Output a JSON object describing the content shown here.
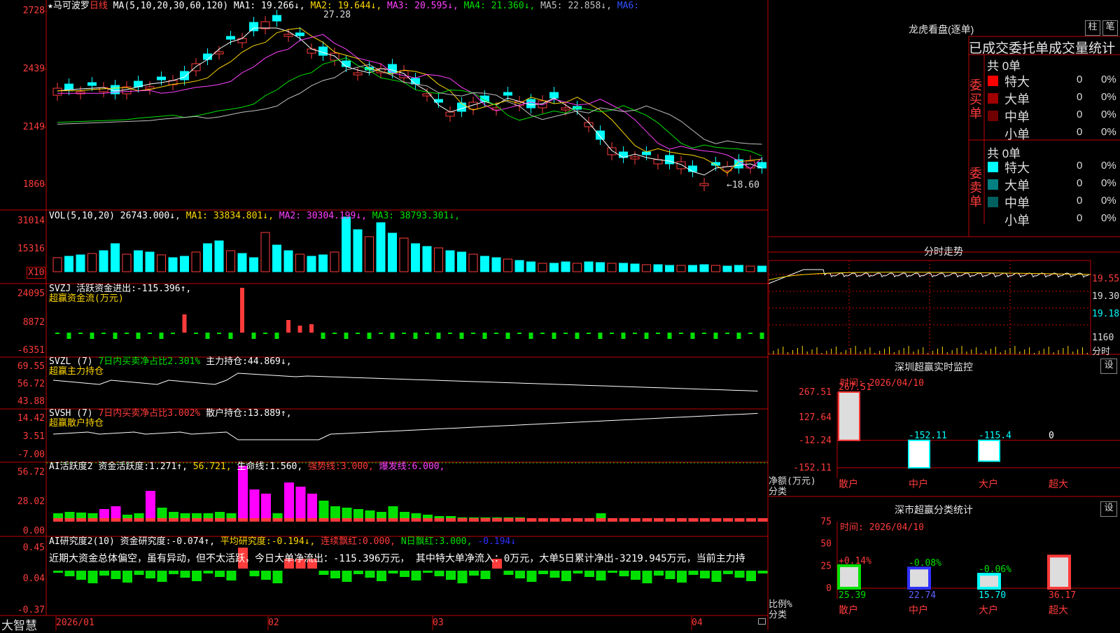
{
  "colors": {
    "up": "#ff3b3b",
    "down": "#00ffff",
    "grid": "#c00000",
    "bg": "#000000",
    "ma1": "#ffffff",
    "ma2": "#ffd800",
    "ma3": "#ff40ff",
    "ma4": "#00e000",
    "ma5": "#c0c0c0"
  },
  "kline": {
    "stock": "★马可波罗",
    "period": "日线",
    "ma_label": "MA(5,10,20,30,60,120)",
    "ma": [
      {
        "name": "MA1:",
        "value": "19.266↓",
        "color": "#ffffff"
      },
      {
        "name": "MA2:",
        "value": "19.644↓",
        "color": "#ffd800"
      },
      {
        "name": "MA3:",
        "value": "20.595↓",
        "color": "#ff40ff"
      },
      {
        "name": "MA4:",
        "value": "21.360↓",
        "color": "#00e000"
      },
      {
        "name": "MA5:",
        "value": "22.858↓",
        "color": "#c0c0c0"
      },
      {
        "name": "MA6:",
        "value": "",
        "color": "#3050ff"
      }
    ],
    "axis": [
      "2728",
      "2439",
      "2149",
      "1860"
    ],
    "high_label": "27.28",
    "low_label": "←18.60"
  },
  "vol": {
    "label": "VOL(5,10,20)",
    "value": "26743.000↓",
    "ma": [
      {
        "name": "MA1:",
        "value": "33834.801↓",
        "color": "#ffd800"
      },
      {
        "name": "MA2:",
        "value": "30304.199↓",
        "color": "#ff40ff"
      },
      {
        "name": "MA3:",
        "value": "38793.301↓",
        "color": "#00e000"
      }
    ],
    "axis": [
      "31014",
      "15316"
    ],
    "unit": "X10"
  },
  "svzj": {
    "label": "SVZJ",
    "text1": "活跃资金进出:",
    "value": "-115.396↑,",
    "line2": "超赢资金流(万元)",
    "axis": [
      "24095",
      "8872",
      "-6351"
    ]
  },
  "svzl": {
    "label": "SVZL (7)",
    "text1": "7日内买卖净占比2.301%",
    "text2": "主力持仓:",
    "value": "44.869↓,",
    "line2": "超赢主力持仓",
    "axis": [
      "69.55",
      "56.72",
      "43.88"
    ]
  },
  "svsh": {
    "label": "SVSH (7)",
    "text1": "7日内买卖净占比3.002%",
    "text2": "散户持仓:",
    "value": "13.889↑,",
    "line2": "超赢散户持仓",
    "axis": [
      "14.42",
      "3.51",
      "-7.00"
    ]
  },
  "ai2": {
    "label": "AI活跃度2",
    "text1": "资金活跃度:",
    "value1": "1.271↑,",
    "value2": "56.721,",
    "text2": "生命线:",
    "value3": "1.560,",
    "text4": "强势线:",
    "value4": "3.000,",
    "text5": "爆发线:",
    "value5": "6.000,",
    "axis": [
      "56.72",
      "28.02",
      "0.00"
    ]
  },
  "ai_research": {
    "label": "AI研究度2(10)",
    "text1": "资金研究度:",
    "value1": "-0.074↑,",
    "text2": "平均研究度:",
    "value2": "-0.194↓,",
    "text3": "连续飘红:",
    "value3": "0.000,",
    "text4": "N日飘红:",
    "value4": "3.000,",
    "value5": "-0.194↓",
    "summary": "近期大资金总体偏空，虽有异动，但不太活跃，今日大单净流出：-115.396万元， 其中特大单净流入：0万元，大单5日累计净出-3219.945万元，当前主力持",
    "axis": [
      "0.45",
      "0.04",
      "-0.37"
    ]
  },
  "dates": [
    "2026/01",
    "02",
    "03",
    "04"
  ],
  "brand": "大智慧",
  "dragon": {
    "title": "龙虎看盘(逐单)",
    "btn1": "柱",
    "btn2": "笔",
    "subtitle": "已成交委托单成交量统计",
    "buy": {
      "label": "委买单",
      "total": "共 0单",
      "rows": [
        {
          "name": "特大",
          "v": "0",
          "p": "0%",
          "color": "#ff0000"
        },
        {
          "name": "大单",
          "v": "0",
          "p": "0%",
          "color": "#a00000"
        },
        {
          "name": "中单",
          "v": "0",
          "p": "0%",
          "color": "#700000"
        },
        {
          "name": "小单",
          "v": "0",
          "p": "0%",
          "color": "#000000"
        }
      ]
    },
    "sell": {
      "label": "委卖单",
      "total": "共 0单",
      "rows": [
        {
          "name": "特大",
          "v": "0",
          "p": "0%",
          "color": "#00ffff"
        },
        {
          "name": "大单",
          "v": "0",
          "p": "0%",
          "color": "#008080"
        },
        {
          "name": "中单",
          "v": "0",
          "p": "0%",
          "color": "#006060"
        },
        {
          "name": "小单",
          "v": "0",
          "p": "0%",
          "color": "#000000"
        }
      ]
    }
  },
  "intraday": {
    "title": "分时走势",
    "axis": [
      "19.55",
      "19.30",
      "19.18"
    ],
    "vol": "1160",
    "vol_unit": "分时"
  },
  "sz_monitor": {
    "title": "深圳超赢实时监控",
    "btn": "设",
    "time": "时间: 2026/04/10",
    "axis": [
      "267.51",
      "127.64",
      "-12.24",
      "-152.11"
    ],
    "ylabel": "净额(万元)",
    "xlabel": "分类",
    "chart_data": {
      "type": "bar",
      "categories": [
        "散户",
        "中户",
        "大户",
        "超大"
      ],
      "values": [
        267.51,
        -152.11,
        -115.4,
        0
      ],
      "value_labels": [
        "267.51",
        "-152.11",
        "-115.4",
        "0"
      ],
      "ylim": [
        -152.11,
        267.51
      ]
    }
  },
  "sz_class": {
    "title": "深市超赢分类统计",
    "btn": "设",
    "time": "时间: 2026/04/10",
    "axis": [
      "75",
      "50",
      "25",
      "0"
    ],
    "ylabel": "比例%",
    "xlabel": "分类",
    "chart_data": {
      "type": "bar",
      "categories": [
        "散户",
        "中户",
        "大户",
        "超大"
      ],
      "values": [
        25.39,
        22.74,
        15.7,
        36.17
      ],
      "deltas": [
        "+0.14%",
        "-0.08%",
        "-0.06%",
        ""
      ],
      "ylim": [
        0,
        75
      ]
    }
  }
}
